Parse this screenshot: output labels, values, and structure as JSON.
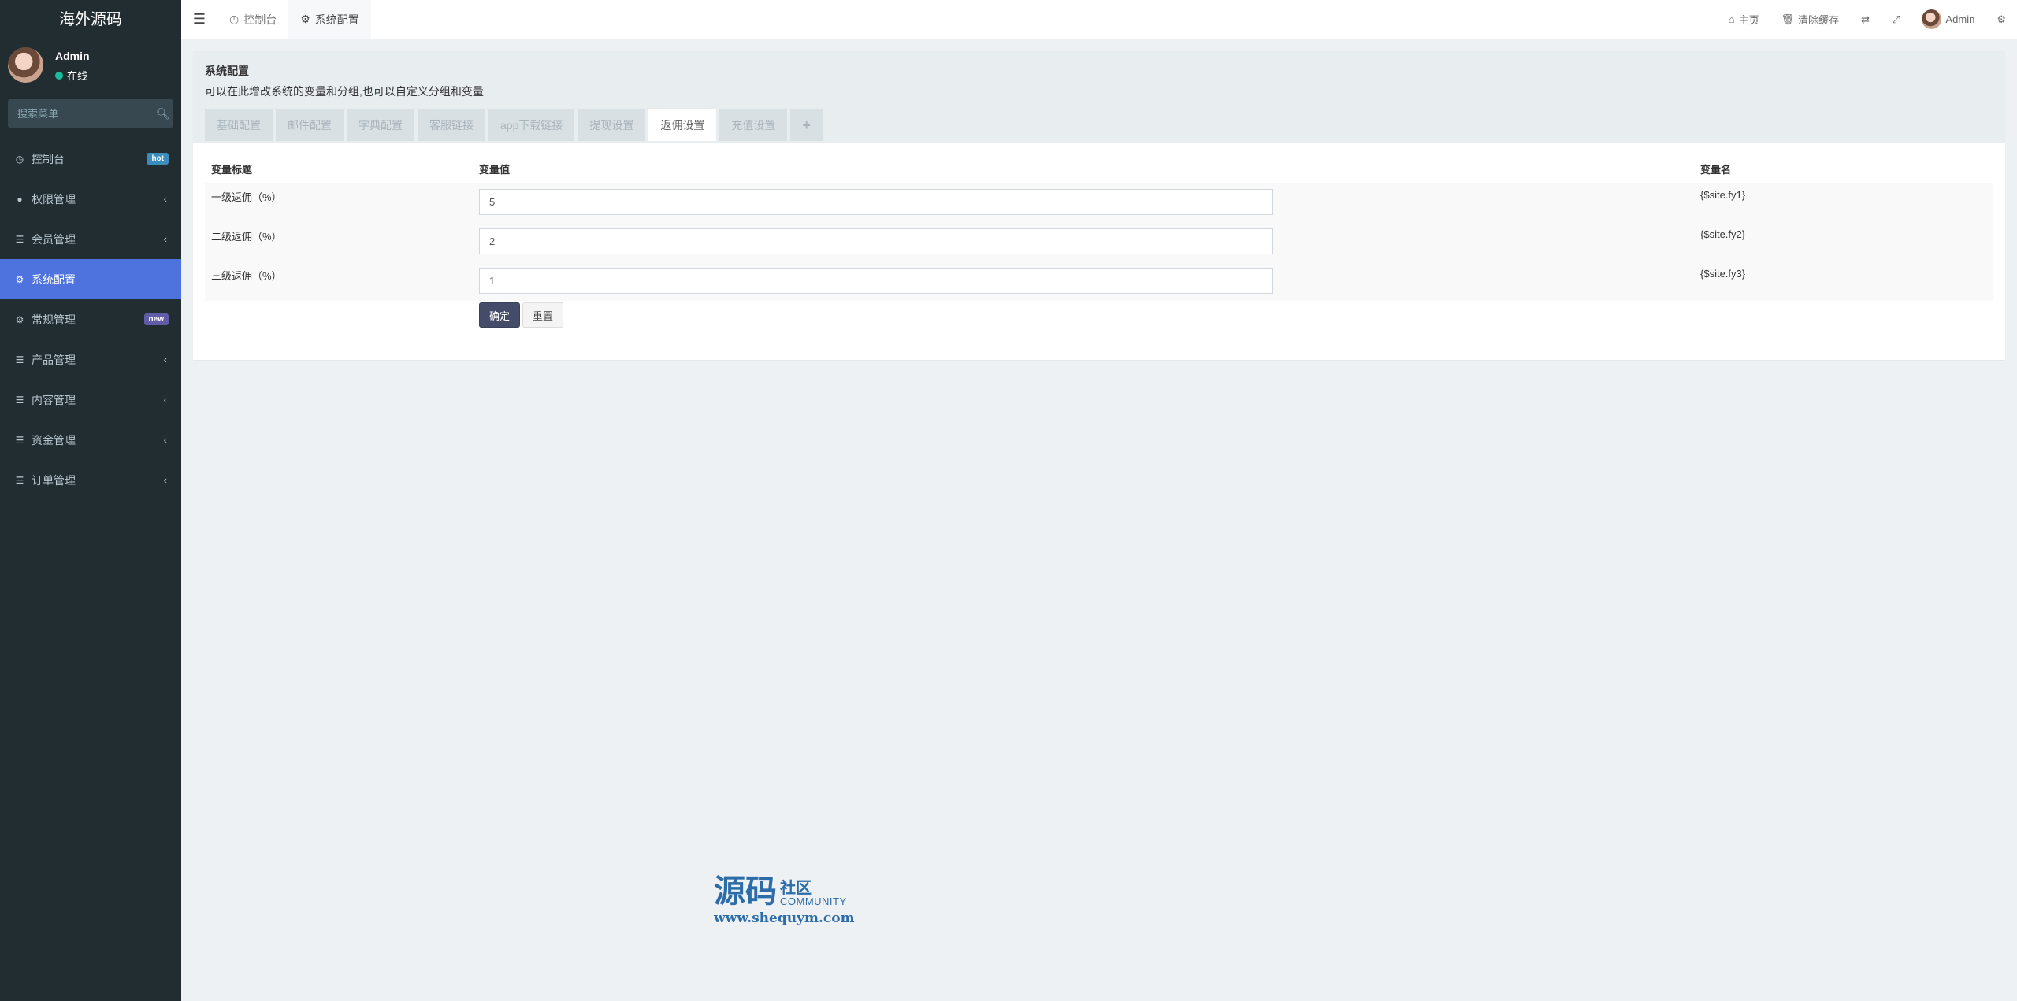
{
  "sidebar": {
    "logo": "海外源码",
    "user": {
      "name": "Admin",
      "status": "在线"
    },
    "search_placeholder": "搜索菜单",
    "items": [
      {
        "label": "控制台",
        "icon": "dashboard-icon",
        "badge": "hot"
      },
      {
        "label": "权限管理",
        "icon": "users-icon",
        "chevron": "‹"
      },
      {
        "label": "会员管理",
        "icon": "list-icon",
        "chevron": "‹"
      },
      {
        "label": "系统配置",
        "icon": "gear-icon",
        "active": true
      },
      {
        "label": "常规管理",
        "icon": "cogs-icon",
        "badge": "new"
      },
      {
        "label": "产品管理",
        "icon": "list-icon",
        "chevron": "‹"
      },
      {
        "label": "内容管理",
        "icon": "list-icon",
        "chevron": "‹"
      },
      {
        "label": "资金管理",
        "icon": "list-icon",
        "chevron": "‹"
      },
      {
        "label": "订单管理",
        "icon": "list-icon",
        "chevron": "‹"
      }
    ]
  },
  "topbar": {
    "tabs": [
      {
        "label": "控制台",
        "icon": "dashboard-icon"
      },
      {
        "label": "系统配置",
        "icon": "gear-icon",
        "active": true
      }
    ],
    "home": "主页",
    "clear_cache": "清除缓存",
    "user": "Admin"
  },
  "panel": {
    "title": "系统配置",
    "description": "可以在此增改系统的变量和分组,也可以自定义分组和变量",
    "tabs": [
      "基础配置",
      "邮件配置",
      "字典配置",
      "客服链接",
      "app下载链接",
      "提现设置",
      "返佣设置",
      "充值设置"
    ],
    "active_tab": "返佣设置",
    "add_tab": "+",
    "columns": {
      "title": "变量标题",
      "value": "变量值",
      "name": "变量名"
    },
    "rows": [
      {
        "title": "一级返佣（%）",
        "value": "5",
        "name": "{$site.fy1}"
      },
      {
        "title": "二级返佣（%）",
        "value": "2",
        "name": "{$site.fy2}"
      },
      {
        "title": "三级返佣（%）",
        "value": "1",
        "name": "{$site.fy3}"
      }
    ],
    "submit": "确定",
    "reset": "重置"
  },
  "watermark": {
    "big": "源码",
    "side": "社区",
    "community": "COMMUNITY",
    "url": "www.shequym.com"
  },
  "colors": {
    "sidebar_bg": "#222d32",
    "active": "#4e73df",
    "primary_btn": "#444c69"
  }
}
